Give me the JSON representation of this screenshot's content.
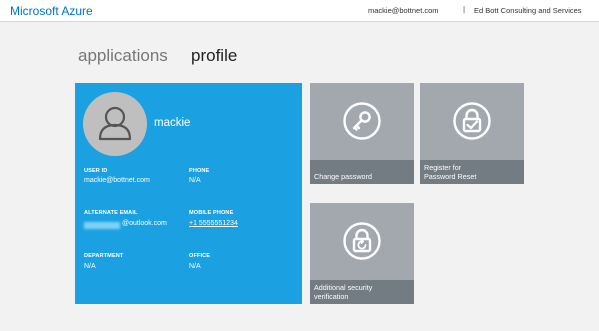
{
  "header": {
    "brand": "Microsoft Azure",
    "user_email": "mackie@bottnet.com",
    "separator": "|",
    "organization": "Ed Bott Consulting and Services"
  },
  "tabs": [
    {
      "label": "applications"
    },
    {
      "label": "profile"
    }
  ],
  "profile": {
    "name": "mackie",
    "avatar_icon": "person-icon",
    "fields": {
      "user_id": {
        "label": "USER ID",
        "value": "mackie@bottnet.com"
      },
      "phone": {
        "label": "PHONE",
        "value": "N/A"
      },
      "alternate_email": {
        "label": "ALTERNATE EMAIL",
        "value": "@outlook.com"
      },
      "mobile_phone": {
        "label": "MOBILE PHONE",
        "value": "+1 5555551234"
      },
      "department": {
        "label": "DEPARTMENT",
        "value": "N/A"
      },
      "office": {
        "label": "OFFICE",
        "value": "N/A"
      }
    }
  },
  "tiles": {
    "change_password": {
      "label": "Change password",
      "icon": "key-icon"
    },
    "register_password_reset": {
      "label_line1": "Register for",
      "label_line2": "Password Reset",
      "icon": "lock-check-icon"
    },
    "additional_verification": {
      "label_line1": "Additional security",
      "label_line2": "verification",
      "icon": "lock-refresh-icon"
    }
  },
  "colors": {
    "brand_blue": "#0072c6",
    "profile_tile": "#1ba1e2",
    "action_tile": "#a3a8ae",
    "action_band": "#737b83"
  }
}
